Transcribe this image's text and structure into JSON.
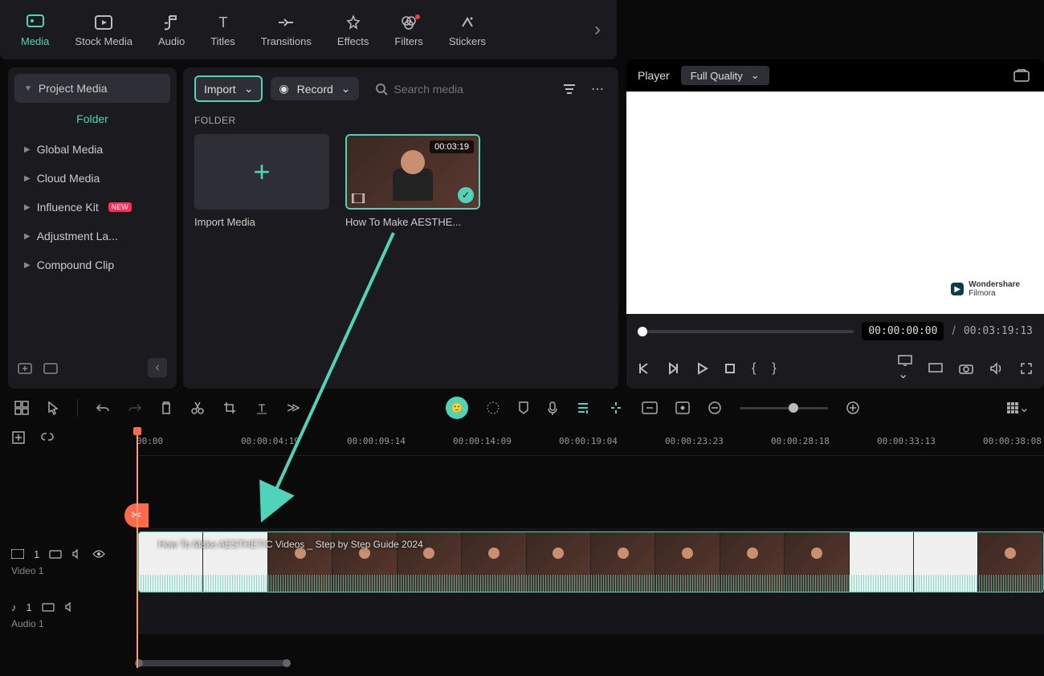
{
  "nav": {
    "tabs": [
      "Media",
      "Stock Media",
      "Audio",
      "Titles",
      "Transitions",
      "Effects",
      "Filters",
      "Stickers"
    ],
    "active": 0
  },
  "sidebar": {
    "items": [
      {
        "label": "Project Media",
        "active": true
      },
      {
        "label": "Global Media"
      },
      {
        "label": "Cloud Media"
      },
      {
        "label": "Influence Kit",
        "badge": "NEW"
      },
      {
        "label": "Adjustment La..."
      },
      {
        "label": "Compound Clip"
      }
    ],
    "folder_label": "Folder"
  },
  "center": {
    "import_label": "Import",
    "record_label": "Record",
    "search_placeholder": "Search media",
    "folder_header": "FOLDER",
    "cards": [
      {
        "type": "import",
        "label": "Import Media"
      },
      {
        "type": "clip",
        "label": "How To Make AESTHE...",
        "duration": "00:03:19",
        "selected": true
      }
    ]
  },
  "player": {
    "title": "Player",
    "quality": "Full Quality",
    "watermark": "Wondershare Filmora",
    "current_time": "00:00:00:00",
    "total_time": "00:03:19:13"
  },
  "timeline": {
    "ruler": [
      "00:00",
      "00:00:04:19",
      "00:00:09:14",
      "00:00:14:09",
      "00:00:19:04",
      "00:00:23:23",
      "00:00:28:18",
      "00:00:33:13",
      "00:00:38:08"
    ],
    "video_track": {
      "index": "1",
      "label": "Video 1"
    },
    "audio_track": {
      "index": "1",
      "label": "Audio 1"
    },
    "clip_title": "How To Make AESTHETIC Videos _ Step by Step Guide 2024"
  }
}
